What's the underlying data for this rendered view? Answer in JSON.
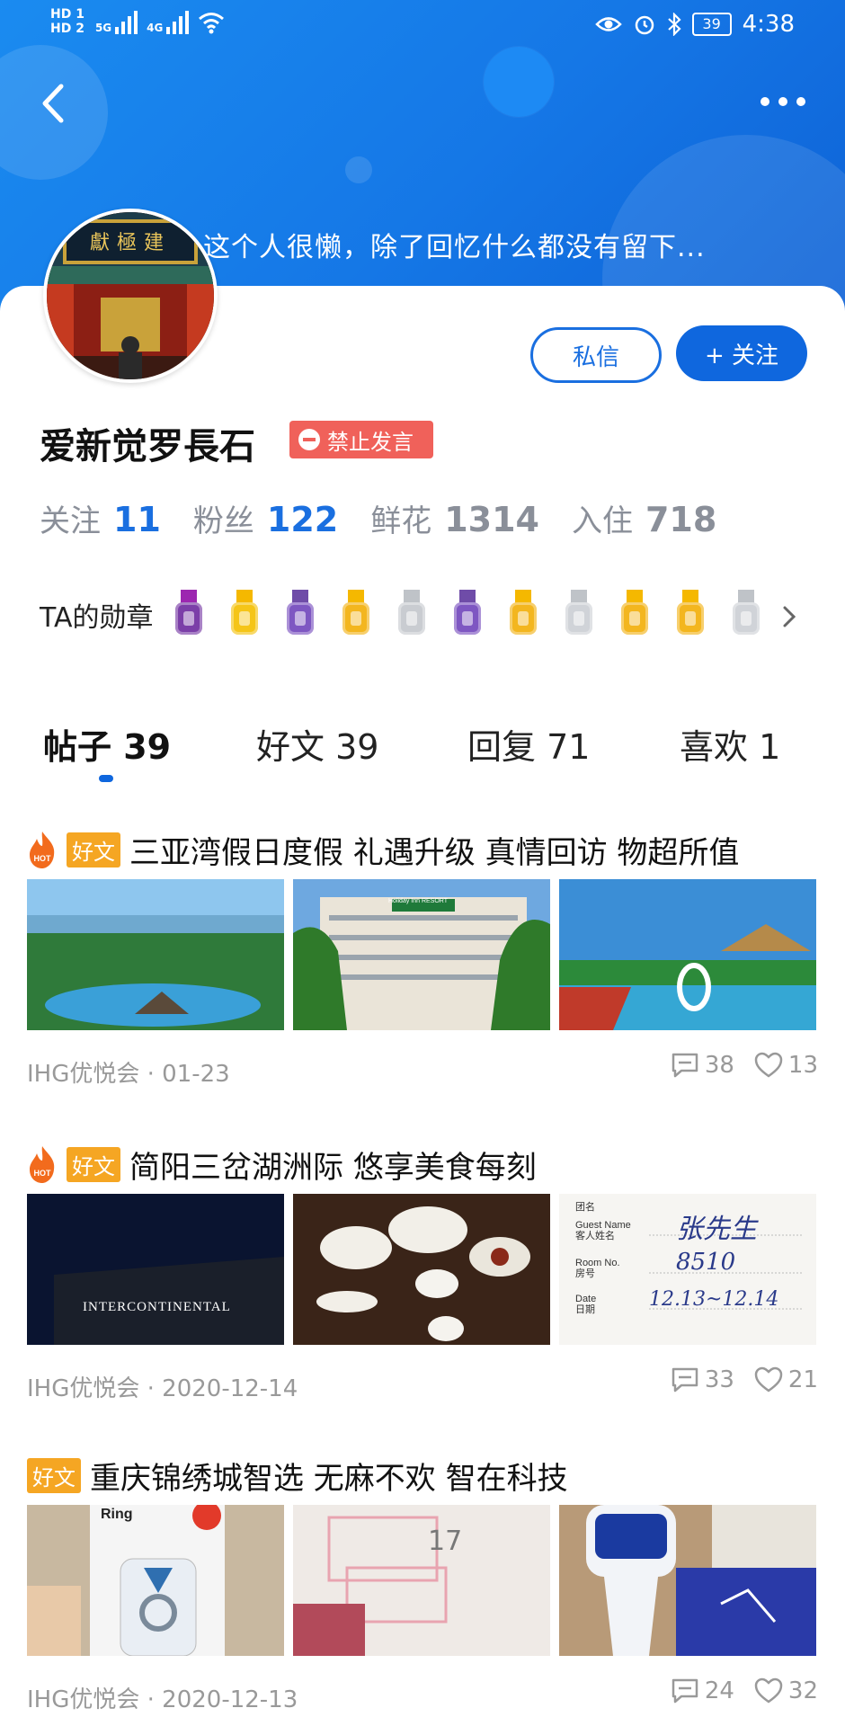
{
  "status": {
    "hd1": "HD 1",
    "hd2": "HD 2",
    "net1": "5G",
    "net2": "4G",
    "battery": "39",
    "time": "4:38"
  },
  "profile": {
    "bio": "这个人很懒，除了回忆什么都没有留下...",
    "username": "爱新觉罗長石",
    "ban_label": "禁止发言",
    "message_label": "私信",
    "follow_label": "+ 关注",
    "avatar_plaque": "獻極建"
  },
  "stats": [
    {
      "label": "关注",
      "value": "11",
      "color": "#1a6fe0"
    },
    {
      "label": "粉丝",
      "value": "122",
      "color": "#1a6fe0"
    },
    {
      "label": "鲜花",
      "value": "1314",
      "color": "#8a8f99"
    },
    {
      "label": "入住",
      "value": "718",
      "color": "#8a8f99"
    }
  ],
  "medals": {
    "label": "TA的勋章",
    "items": [
      {
        "name": "ihg-medal-icon",
        "ribbon": "#9c27b0",
        "body": "#7b3fa8"
      },
      {
        "name": "plane-medal-icon",
        "ribbon": "#f5b800",
        "body": "#f5c518"
      },
      {
        "name": "building-purple-medal-icon",
        "ribbon": "#6f4ca8",
        "body": "#7e57c2"
      },
      {
        "name": "building-gold-medal-icon",
        "ribbon": "#f5b800",
        "body": "#f3b61f"
      },
      {
        "name": "building-silver-medal-icon",
        "ribbon": "#bfc3c8",
        "body": "#c9ccd1"
      },
      {
        "name": "flame-purple-medal-icon",
        "ribbon": "#6f4ca8",
        "body": "#7e57c2"
      },
      {
        "name": "flame-gold-medal-icon",
        "ribbon": "#f5b800",
        "body": "#f3b61f"
      },
      {
        "name": "flame-silver-medal-icon",
        "ribbon": "#bfc3c8",
        "body": "#d0d3d8"
      },
      {
        "name": "pen-gold-medal-icon",
        "ribbon": "#f5b800",
        "body": "#f3b61f"
      },
      {
        "name": "leaf-gold-medal-icon",
        "ribbon": "#f5b800",
        "body": "#f3b61f"
      },
      {
        "name": "gem-silver-medal-icon",
        "ribbon": "#bfc3c8",
        "body": "#d0d3d8"
      }
    ]
  },
  "tabs": [
    {
      "label": "帖子 39"
    },
    {
      "label": "好文 39"
    },
    {
      "label": "回复 71"
    },
    {
      "label": "喜欢 1"
    }
  ],
  "posts": [
    {
      "hot": true,
      "tag": "好文",
      "title": "三亚湾假日度假 礼遇升级 真情回访 物超所值",
      "meta": "IHG优悦会 · 01-23",
      "comments": "38",
      "likes": "13",
      "thumb_texts": [
        "",
        "Holiday Inn RESORT",
        ""
      ]
    },
    {
      "hot": true,
      "tag": "好文",
      "title": "简阳三岔湖洲际 悠享美食每刻",
      "meta": "IHG优悦会 · 2020-12-14",
      "comments": "33",
      "likes": "21",
      "thumb_texts": [
        "INTERCONTINENTAL",
        "",
        "张先生"
      ]
    },
    {
      "hot": false,
      "tag": "好文",
      "title": "重庆锦绣城智选 无麻不欢 智在科技",
      "meta": "IHG优悦会 · 2020-12-13",
      "comments": "24",
      "likes": "32",
      "thumb_texts": [
        "Ring",
        "",
        ""
      ]
    }
  ],
  "colors": {
    "accent": "#0f67de",
    "ban": "#f0615a",
    "tag": "#f5a623",
    "hot": "#f26b1d"
  }
}
